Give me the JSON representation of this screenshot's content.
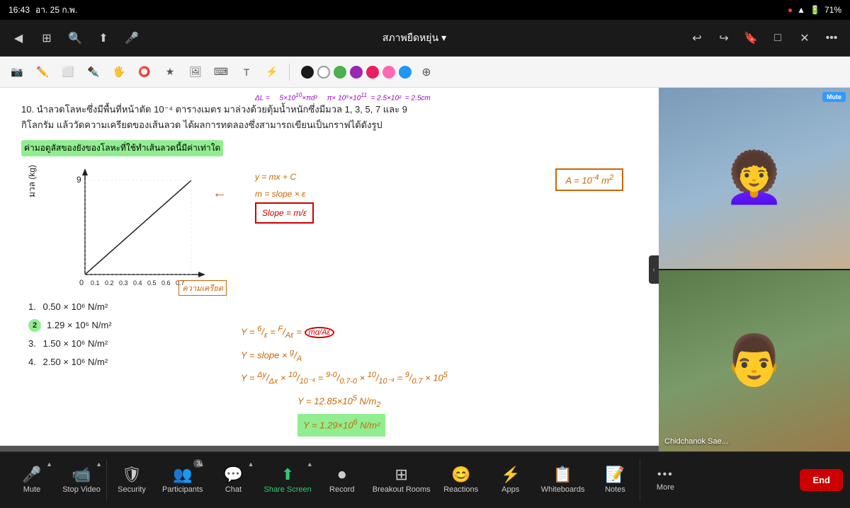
{
  "status_bar": {
    "time": "16:43",
    "day": "อา. 25 ก.พ.",
    "battery": "71%",
    "record_dot": "●"
  },
  "top_toolbar": {
    "meeting_title": "สภาพยืดหยุ่น",
    "dropdown_icon": "▾"
  },
  "drawing_toolbar": {
    "tools": [
      "🔍",
      "✏️",
      "⬜",
      "✒️",
      "🖐",
      "⭕",
      "★",
      "🖼",
      "⌨",
      "T",
      "⚡"
    ],
    "colors": [
      "#666",
      "#fff",
      "#4caf50",
      "#9c27b0",
      "#e91e63",
      "#ff69b4",
      "#2196f3",
      "➕"
    ]
  },
  "whiteboard": {
    "question": "10. นำลวดโลหะซึ่งมีพื้นที่หน้าตัด 10⁻⁴ ตารางเมตร มาล่วงด้วยตุ้มน้ำหนักซึ่งมีมวล 1, 3, 5, 7 และ 9\nกิโลกรัม แล้ววัดความเครียดของเส้นลวด ได้ผลการทดลองซึ่งสามารถเขียนเป็นกราฟได้ดังรูป",
    "highlight_text": "ค่ามอดูลัสของยังของโลหะที่ใช้ทำเส้นลวดนี้มีค่าเท่าใด",
    "graph_label": "มวล (kg)",
    "graph_max": "9",
    "graph_x_labels": [
      "0.1",
      "0.2",
      "0.3",
      "0.4",
      "0.5",
      "0.6",
      "0.7"
    ],
    "graph_x_axis": "ความเครียด",
    "answers": [
      {
        "num": "1.",
        "text": "0.50 × 10⁶ N/m²"
      },
      {
        "num": "2.",
        "text": "1.29 × 10⁶ N/m²",
        "highlighted": true
      },
      {
        "num": "3.",
        "text": "1.50 × 10⁶ N/m²"
      },
      {
        "num": "4.",
        "text": "2.50 × 10⁶ N/m²"
      }
    ],
    "formula_top": "ΔL = 5×10¹⁰×πd²   π× 10⁵×10¹¹ = 2.5×10²  = 2.5cm",
    "formula_right_1": "y = mx + C",
    "formula_right_2": "m = slope × ε",
    "formula_slope": "Slope = m/ε",
    "formula_box": "A = 10⁻⁴ m²",
    "formula_y1": "Y = 6/ε = F/Aε = mg/Aε",
    "formula_y2": "Y = slope × g/A",
    "formula_y3": "Y = Δy/Δx × 10/10⁻⁴ = 9-0/0.7-0 × 10/10⁻⁴ = 9/0.7 × 10⁵",
    "formula_y4": "Y = 12.85×10⁵ N/m₂",
    "formula_y5": "Y = 1.29×10⁶ N/m²"
  },
  "sidebar": {
    "person1": {
      "emoji": "👩",
      "name": "Chidchanok Sae...",
      "mute": "Mute"
    },
    "person2": {
      "emoji": "👨"
    }
  },
  "bottom_toolbar": {
    "items": [
      {
        "id": "mute",
        "label": "Mute",
        "icon": "🎤",
        "has_chevron": true
      },
      {
        "id": "stop-video",
        "label": "Stop Video",
        "icon": "📹",
        "has_chevron": true
      },
      {
        "id": "security",
        "label": "Security",
        "icon": "🛡"
      },
      {
        "id": "participants",
        "label": "Participants",
        "icon": "👥",
        "badge": "3",
        "has_chevron": true
      },
      {
        "id": "chat",
        "label": "Chat",
        "icon": "💬",
        "has_chevron": true
      },
      {
        "id": "share-screen",
        "label": "Share Screen",
        "icon": "⬆",
        "highlight": true,
        "has_chevron": true
      },
      {
        "id": "record",
        "label": "Record",
        "icon": "⏺"
      },
      {
        "id": "breakout-rooms",
        "label": "Breakout Rooms",
        "icon": "⊞"
      },
      {
        "id": "reactions",
        "label": "Reactions",
        "icon": "😊"
      },
      {
        "id": "apps",
        "label": "Apps",
        "icon": "⚡"
      },
      {
        "id": "whiteboards",
        "label": "Whiteboards",
        "icon": "📋"
      },
      {
        "id": "notes",
        "label": "Notes",
        "icon": "📝"
      },
      {
        "id": "more",
        "label": "More",
        "icon": "•••"
      }
    ],
    "end_label": "End"
  }
}
